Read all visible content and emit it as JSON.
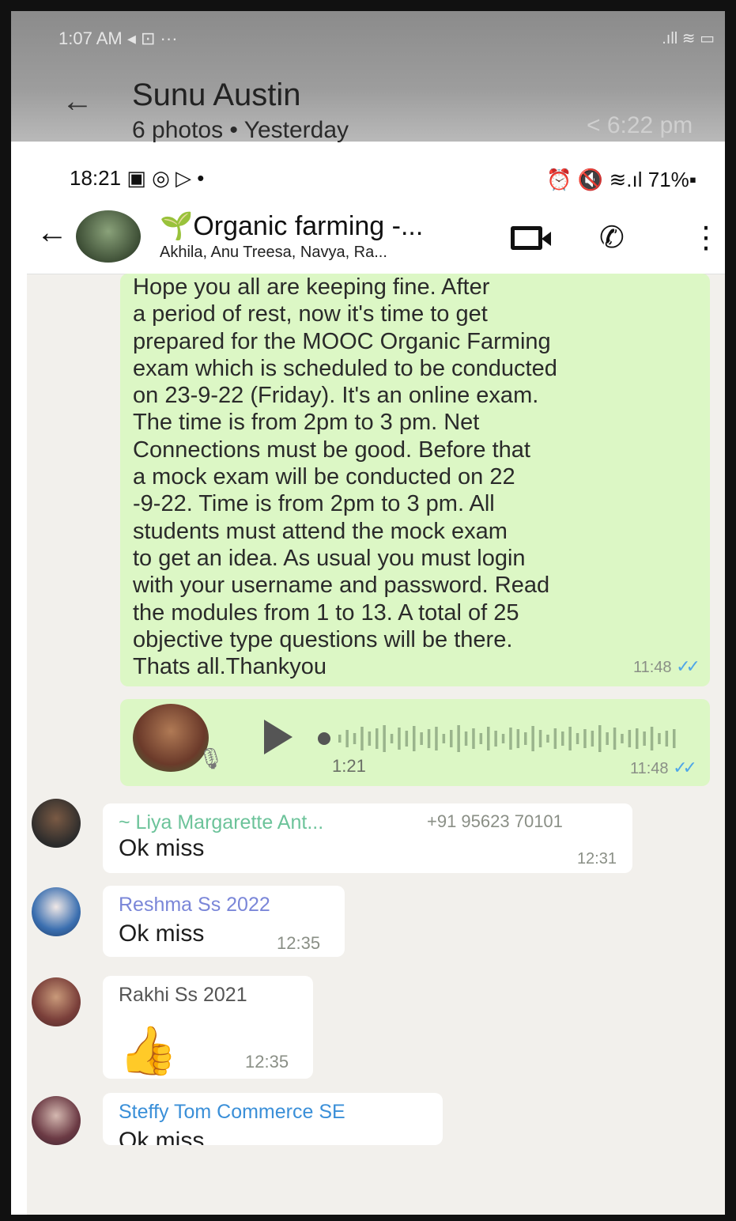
{
  "outer": {
    "status_time": "1:07 AM",
    "status_icons": "◂ ⊡ ···",
    "status_right": ".ıll ≋ ▭",
    "back_icon": "back-arrow-icon",
    "contact_name": "Sunu Austin",
    "subtitle": "6 photos  •  Yesterday",
    "time": "< 6:22 pm"
  },
  "inner": {
    "status": {
      "time": "18:21",
      "right": "⏰ 🔇 ≋.ıl 71%▪"
    },
    "header": {
      "title": "🌱Organic farming -...",
      "members": "Akhila, Anu Treesa, Navya, Ra..."
    }
  },
  "messages": {
    "announcement": {
      "text": "Hope you all are keeping fine. After\na period of rest, now it's time to get\nprepared for the MOOC  Organic Farming\nexam which is scheduled to be conducted\non 23-9-22 (Friday). It's an online exam.\nThe time is from 2pm to 3 pm. Net\nConnections  must be good. Before that\na mock exam will be conducted on  22\n-9-22. Time is from 2pm to 3 pm. All\nstudents must attend the mock exam\nto get an idea. As usual you must login\nwith your username and password. Read\nthe modules from 1 to 13. A total of 25\nobjective type questions will be there.\nThats all.Thankyou",
      "time": "11:48",
      "ticks": "✓✓"
    },
    "voice": {
      "duration": "1:21",
      "time": "11:48",
      "ticks": "✓✓"
    },
    "replies": [
      {
        "sender": "~ Liya Margarette Ant...",
        "phone": "+91 95623 70101",
        "text": "Ok miss",
        "time": "12:31",
        "sender_color": "#6cc39a"
      },
      {
        "sender": "Reshma Ss 2022",
        "text": "Ok miss",
        "time": "12:35",
        "sender_color": "#7a86d8"
      },
      {
        "sender": "Rakhi Ss 2021",
        "text": "👍",
        "time": "12:35",
        "sender_color": "#555555"
      },
      {
        "sender": "Steffy Tom Commerce SE",
        "text": "Ok miss",
        "sender_color": "#3a8fd8"
      }
    ]
  },
  "colors": {
    "outgoing_bubble": "#dcf7c5",
    "incoming_bubble": "#ffffff",
    "read_ticks": "#4fa6e8"
  }
}
